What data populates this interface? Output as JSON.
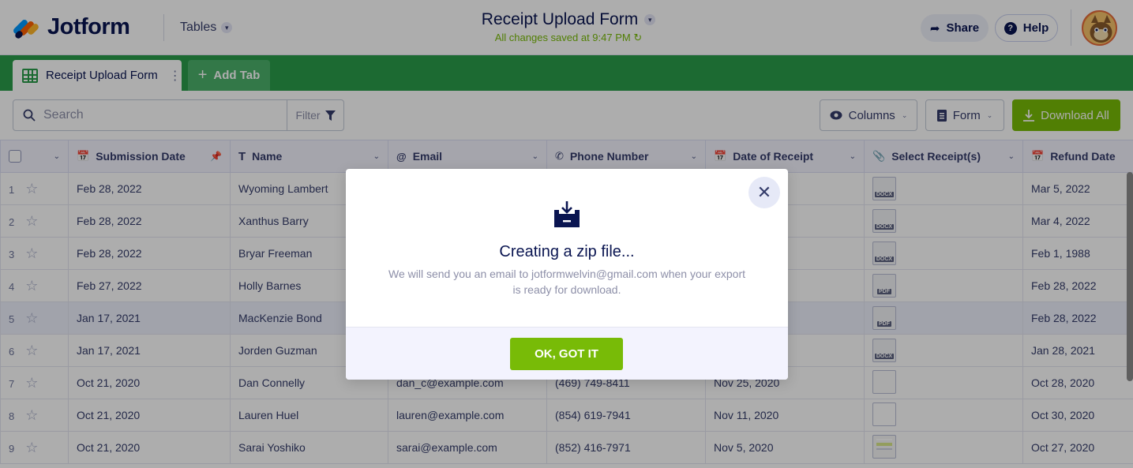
{
  "header": {
    "logo_text": "Jotform",
    "tables_label": "Tables",
    "form_title": "Receipt Upload Form",
    "saved_status": "All changes saved at 9:47 PM",
    "share_label": "Share",
    "help_label": "Help"
  },
  "tabs": {
    "active_label": "Receipt Upload Form",
    "add_label": "Add Tab"
  },
  "toolbar": {
    "search_placeholder": "Search",
    "filter_label": "Filter",
    "columns_label": "Columns",
    "form_label": "Form",
    "download_label": "Download All"
  },
  "table": {
    "columns": [
      "Submission Date",
      "Name",
      "Email",
      "Phone Number",
      "Date of Receipt",
      "Select Receipt(s)",
      "Refund Date"
    ],
    "rows": [
      {
        "num": "1",
        "submission_date": "Feb 28, 2022",
        "name": "Wyoming Lambert",
        "email": "",
        "phone": "",
        "receipt_date": "",
        "file": "DOCX",
        "refund_date": "Mar 5, 2022"
      },
      {
        "num": "2",
        "submission_date": "Feb 28, 2022",
        "name": "Xanthus Barry",
        "email": "",
        "phone": "",
        "receipt_date": "",
        "file": "DOCX",
        "refund_date": "Mar 4, 2022"
      },
      {
        "num": "3",
        "submission_date": "Feb 28, 2022",
        "name": "Bryar Freeman",
        "email": "",
        "phone": "",
        "receipt_date": "",
        "file": "DOCX",
        "refund_date": "Feb 1, 1988"
      },
      {
        "num": "4",
        "submission_date": "Feb 27, 2022",
        "name": "Holly Barnes",
        "email": "",
        "phone": "",
        "receipt_date": "",
        "file": "PDF",
        "refund_date": "Feb 28, 2022"
      },
      {
        "num": "5",
        "submission_date": "Jan 17, 2021",
        "name": "MacKenzie Bond",
        "email": "",
        "phone": "",
        "receipt_date": "",
        "file": "PDF",
        "refund_date": "Feb 28, 2022"
      },
      {
        "num": "6",
        "submission_date": "Jan 17, 2021",
        "name": "Jorden Guzman",
        "email": "",
        "phone": "",
        "receipt_date": "",
        "file": "DOCX",
        "refund_date": "Jan 28, 2021"
      },
      {
        "num": "7",
        "submission_date": "Oct 21, 2020",
        "name": "Dan Connelly",
        "email": "dan_c@example.com",
        "phone": "(469) 749-8411",
        "receipt_date": "Nov 25, 2020",
        "file": "",
        "refund_date": "Oct 28, 2020"
      },
      {
        "num": "8",
        "submission_date": "Oct 21, 2020",
        "name": "Lauren Huel",
        "email": "lauren@example.com",
        "phone": "(854) 619-7941",
        "receipt_date": "Nov 11, 2020",
        "file": "",
        "refund_date": "Oct 30, 2020"
      },
      {
        "num": "9",
        "submission_date": "Oct 21, 2020",
        "name": "Sarai Yoshiko",
        "email": "sarai@example.com",
        "phone": "(852) 416-7971",
        "receipt_date": "Nov 5, 2020",
        "file": "",
        "refund_date": "Oct 27, 2020"
      }
    ]
  },
  "modal": {
    "title": "Creating a zip file...",
    "description": "We will send you an email to jotformwelvin@gmail.com when your export is ready for download.",
    "ok_label": "OK, GOT IT"
  },
  "colors": {
    "brand_green": "#2a9d4a",
    "accent_lime": "#78bb07",
    "navy": "#0a1551"
  }
}
